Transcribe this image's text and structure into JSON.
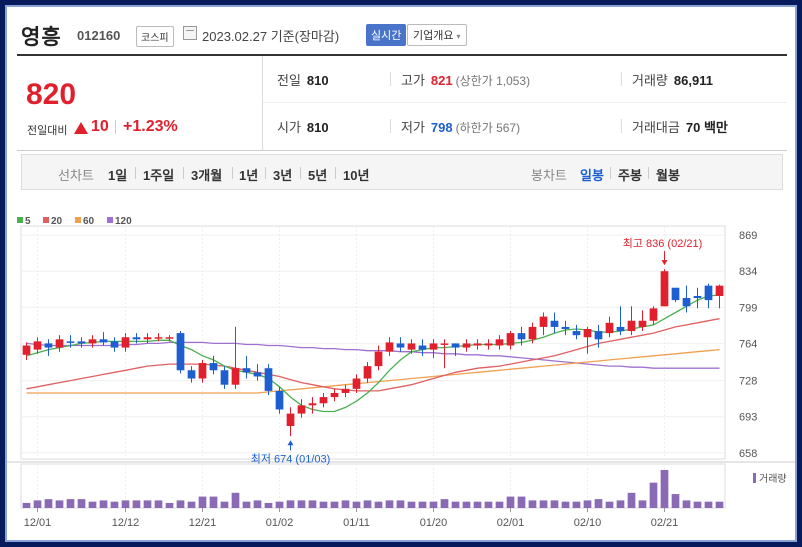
{
  "header": {
    "name": "영흥",
    "code": "012160",
    "market": "코스피",
    "date": "2023.02.27",
    "basis": "기준(장마감)",
    "realtime": "실시간",
    "company_info": "기업개요"
  },
  "price": {
    "current": "820",
    "change_label": "전일대비",
    "change": "10",
    "change_pct": "+1.23%"
  },
  "stats": {
    "prev_close_label": "전일",
    "prev_close": "810",
    "high_label": "고가",
    "high": "821",
    "upper_limit": "(상한가 1,053)",
    "volume_label": "거래량",
    "volume": "86,911",
    "open_label": "시가",
    "open": "810",
    "low_label": "저가",
    "low": "798",
    "lower_limit": "(하한가 567)",
    "value_label": "거래대금",
    "value": "70",
    "value_unit": "백만"
  },
  "tabs": {
    "line_chart": "선차트",
    "periods": [
      "1일",
      "1주일",
      "3개월",
      "1년",
      "3년",
      "5년",
      "10년"
    ],
    "candle_chart": "봉차트",
    "candle_periods": [
      "일봉",
      "주봉",
      "월봉"
    ],
    "active_candle": "일봉"
  },
  "colors": {
    "up": "#e0212d",
    "down": "#1d5fd0",
    "ma5": "#4caf50",
    "ma20": "#e06060",
    "ma60": "#f0a050",
    "ma120": "#a070d0",
    "volume": "#8a6ab5"
  },
  "chart_data": {
    "type": "candlestick",
    "legend": [
      {
        "name": "5",
        "color": "#4caf50"
      },
      {
        "name": "20",
        "color": "#e06060"
      },
      {
        "name": "60",
        "color": "#f0a050"
      },
      {
        "name": "120",
        "color": "#a070d0"
      }
    ],
    "y_ticks": [
      869,
      834,
      799,
      764,
      728,
      693,
      658
    ],
    "ylim": [
      652,
      872
    ],
    "x_ticks": [
      "12/01",
      "12/12",
      "12/21",
      "01/02",
      "01/11",
      "01/20",
      "02/01",
      "02/10",
      "02/21"
    ],
    "x_tick_index": [
      1,
      9,
      16,
      23,
      30,
      37,
      44,
      51,
      58
    ],
    "max_label": "최고 836 (02/21)",
    "max_index": 58,
    "max_value": 836,
    "min_label": "최저 674 (01/03)",
    "min_index": 24,
    "min_value": 674,
    "volume_label": "거래량",
    "candles": [
      [
        753,
        762,
        765,
        748
      ],
      [
        758,
        766,
        770,
        754
      ],
      [
        764,
        760,
        768,
        752
      ],
      [
        760,
        768,
        772,
        756
      ],
      [
        766,
        765,
        772,
        760
      ],
      [
        766,
        764,
        770,
        760
      ],
      [
        764,
        768,
        772,
        760
      ],
      [
        768,
        765,
        775,
        762
      ],
      [
        766,
        760,
        770,
        756
      ],
      [
        760,
        770,
        774,
        756
      ],
      [
        770,
        768,
        774,
        764
      ],
      [
        768,
        770,
        774,
        764
      ],
      [
        770,
        770,
        774,
        766
      ],
      [
        770,
        770,
        772,
        766
      ],
      [
        774,
        738,
        776,
        735
      ],
      [
        738,
        730,
        742,
        726
      ],
      [
        730,
        745,
        748,
        726
      ],
      [
        745,
        738,
        752,
        734
      ],
      [
        738,
        724,
        742,
        720
      ],
      [
        724,
        740,
        780,
        720
      ],
      [
        740,
        736,
        752,
        730
      ],
      [
        736,
        732,
        744,
        728
      ],
      [
        740,
        718,
        744,
        714
      ],
      [
        718,
        700,
        722,
        696
      ],
      [
        684,
        696,
        702,
        674
      ],
      [
        696,
        704,
        710,
        692
      ],
      [
        704,
        706,
        712,
        696
      ],
      [
        706,
        712,
        716,
        702
      ],
      [
        712,
        716,
        720,
        708
      ],
      [
        716,
        720,
        724,
        712
      ],
      [
        720,
        730,
        734,
        716
      ],
      [
        730,
        742,
        746,
        726
      ],
      [
        742,
        756,
        762,
        738
      ],
      [
        756,
        765,
        770,
        752
      ],
      [
        764,
        760,
        770,
        756
      ],
      [
        758,
        764,
        768,
        754
      ],
      [
        762,
        758,
        768,
        752
      ],
      [
        758,
        764,
        768,
        750
      ],
      [
        764,
        764,
        768,
        740
      ],
      [
        764,
        760,
        764,
        752
      ],
      [
        760,
        764,
        768,
        756
      ],
      [
        762,
        764,
        768,
        758
      ],
      [
        762,
        764,
        768,
        758
      ],
      [
        762,
        768,
        772,
        758
      ],
      [
        762,
        774,
        776,
        758
      ],
      [
        774,
        768,
        780,
        762
      ],
      [
        768,
        780,
        784,
        764
      ],
      [
        780,
        790,
        794,
        772
      ],
      [
        786,
        780,
        794,
        774
      ],
      [
        780,
        778,
        786,
        772
      ],
      [
        776,
        772,
        782,
        768
      ],
      [
        770,
        778,
        780,
        754
      ],
      [
        776,
        768,
        782,
        760
      ],
      [
        774,
        784,
        790,
        770
      ],
      [
        780,
        776,
        800,
        772
      ],
      [
        776,
        786,
        800,
        772
      ],
      [
        780,
        786,
        796,
        776
      ],
      [
        786,
        798,
        800,
        782
      ],
      [
        800,
        834,
        836,
        800
      ],
      [
        818,
        806,
        812,
        804
      ],
      [
        808,
        800,
        820,
        794
      ],
      [
        810,
        808,
        818,
        798
      ],
      [
        820,
        806,
        822,
        798
      ],
      [
        810,
        820,
        821,
        798
      ]
    ],
    "ma5": [
      752,
      755,
      758,
      760,
      762,
      764,
      765,
      766,
      766,
      766,
      766,
      766,
      767,
      767,
      762,
      758,
      752,
      748,
      742,
      738,
      736,
      734,
      730,
      722,
      712,
      704,
      700,
      698,
      698,
      702,
      708,
      716,
      726,
      738,
      748,
      756,
      758,
      760,
      760,
      761,
      762,
      763,
      763,
      763,
      764,
      765,
      767,
      770,
      774,
      777,
      778,
      777,
      775,
      775,
      776,
      778,
      780,
      782,
      788,
      794,
      800,
      806,
      810,
      811
    ],
    "ma20": [
      720,
      722,
      724,
      726,
      728,
      730,
      732,
      734,
      736,
      738,
      740,
      742,
      743,
      744,
      744,
      744,
      744,
      743,
      742,
      740,
      738,
      736,
      734,
      732,
      729,
      726,
      724,
      722,
      720,
      719,
      718,
      718,
      718,
      720,
      722,
      724,
      727,
      730,
      733,
      736,
      738,
      740,
      741,
      742,
      744,
      746,
      748,
      750,
      752,
      755,
      758,
      761,
      764,
      766,
      768,
      770,
      772,
      774,
      777,
      780,
      782,
      784,
      786,
      788
    ],
    "ma60": [
      716,
      716,
      716,
      716,
      716,
      716,
      716,
      716,
      716,
      716,
      716,
      716,
      716,
      716,
      716,
      716,
      716,
      716,
      716,
      716,
      716,
      716,
      717,
      718,
      719,
      720,
      721,
      722,
      723,
      724,
      725,
      726,
      727,
      728,
      729,
      730,
      731,
      732,
      733,
      734,
      735,
      736,
      737,
      738,
      739,
      740,
      741,
      742,
      743,
      744,
      745,
      746,
      747,
      748,
      749,
      750,
      751,
      752,
      753,
      754,
      755,
      756,
      757,
      758
    ],
    "ma120": [
      764,
      763,
      762,
      762,
      762,
      762,
      762,
      762,
      762,
      763,
      763,
      764,
      764,
      765,
      765,
      765,
      765,
      764,
      764,
      764,
      763,
      763,
      762,
      762,
      761,
      760,
      760,
      759,
      759,
      758,
      758,
      757,
      757,
      757,
      756,
      756,
      755,
      755,
      754,
      754,
      753,
      753,
      752,
      752,
      751,
      750,
      749,
      748,
      747,
      746,
      745,
      744,
      743,
      742,
      742,
      741,
      741,
      740,
      740,
      740,
      740,
      740,
      740,
      740
    ],
    "volumes": [
      8,
      12,
      14,
      12,
      14,
      14,
      10,
      12,
      10,
      12,
      12,
      12,
      12,
      8,
      12,
      10,
      18,
      18,
      10,
      24,
      10,
      12,
      8,
      10,
      12,
      12,
      12,
      10,
      10,
      12,
      10,
      12,
      10,
      12,
      12,
      10,
      10,
      10,
      14,
      10,
      10,
      10,
      10,
      10,
      18,
      18,
      12,
      12,
      12,
      10,
      10,
      12,
      14,
      10,
      12,
      24,
      12,
      40,
      60,
      22,
      12,
      10,
      10,
      10
    ]
  }
}
